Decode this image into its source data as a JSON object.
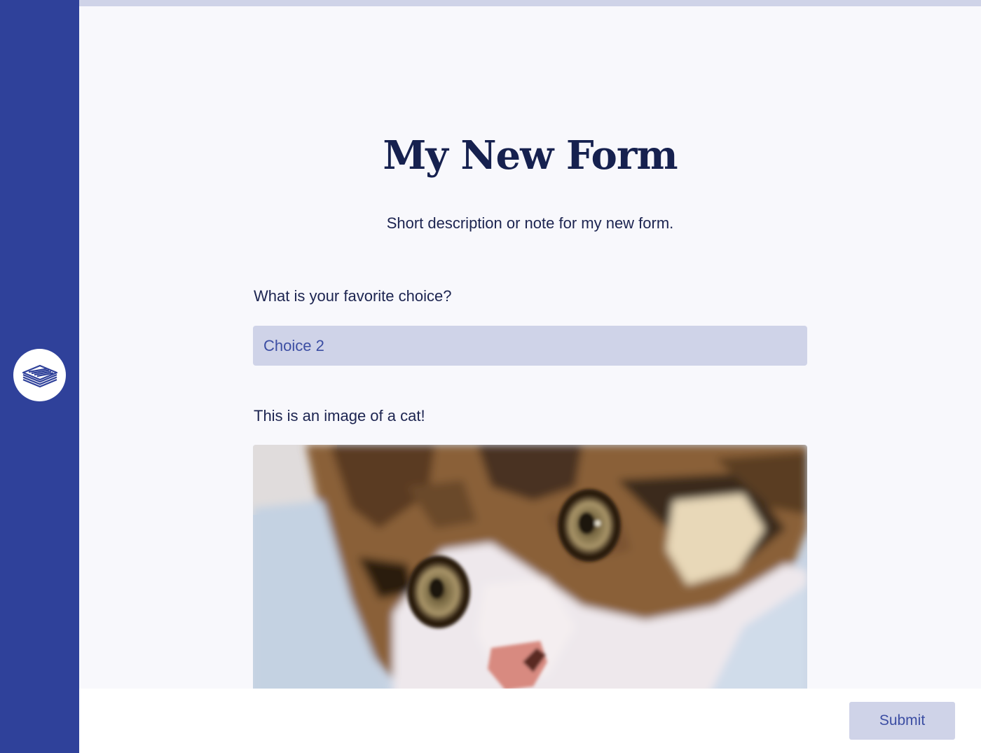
{
  "form": {
    "title": "My New Form",
    "description": "Short description or note for my new form."
  },
  "question": {
    "label": "What is your favorite choice?",
    "selected_value": "Choice 2"
  },
  "image_block": {
    "label": "This is an image of a cat!",
    "image_subject": "cat"
  },
  "footer": {
    "submit_label": "Submit"
  },
  "colors": {
    "sidebar": "#2f419a",
    "accent_light": "#cfd3e8",
    "title_text": "#16214f",
    "link_text": "#3c4ea3"
  },
  "icons": {
    "logo": "stacked-layers-icon"
  }
}
